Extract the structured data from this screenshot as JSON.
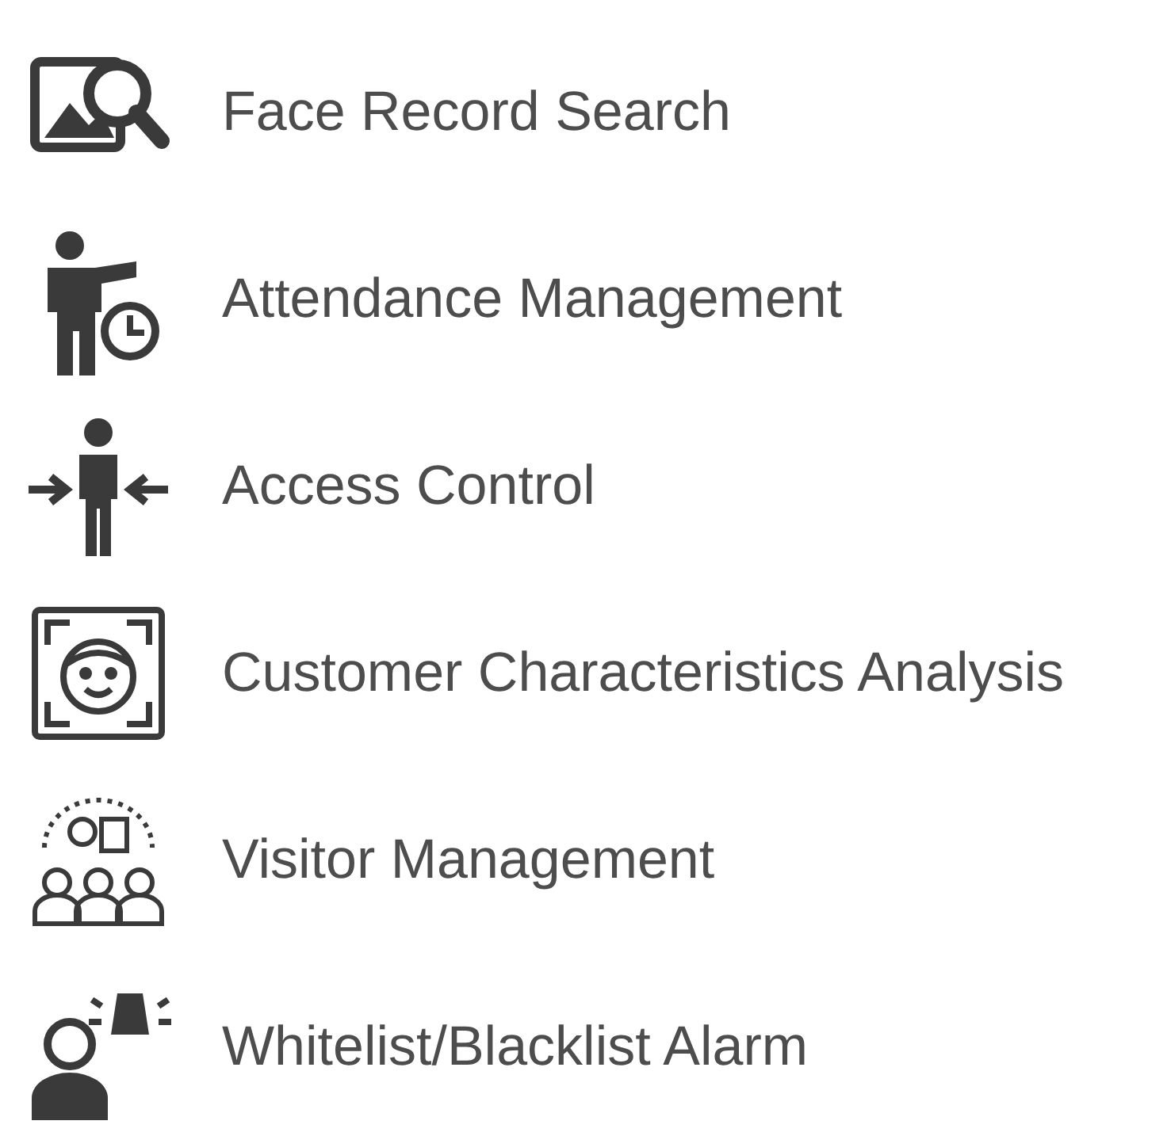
{
  "features": [
    {
      "label": "Face Record Search"
    },
    {
      "label": "Attendance Management"
    },
    {
      "label": "Access Control"
    },
    {
      "label": "Customer Characteristics Analysis"
    },
    {
      "label": "Visitor Management"
    },
    {
      "label": "Whitelist/Blacklist Alarm"
    }
  ]
}
